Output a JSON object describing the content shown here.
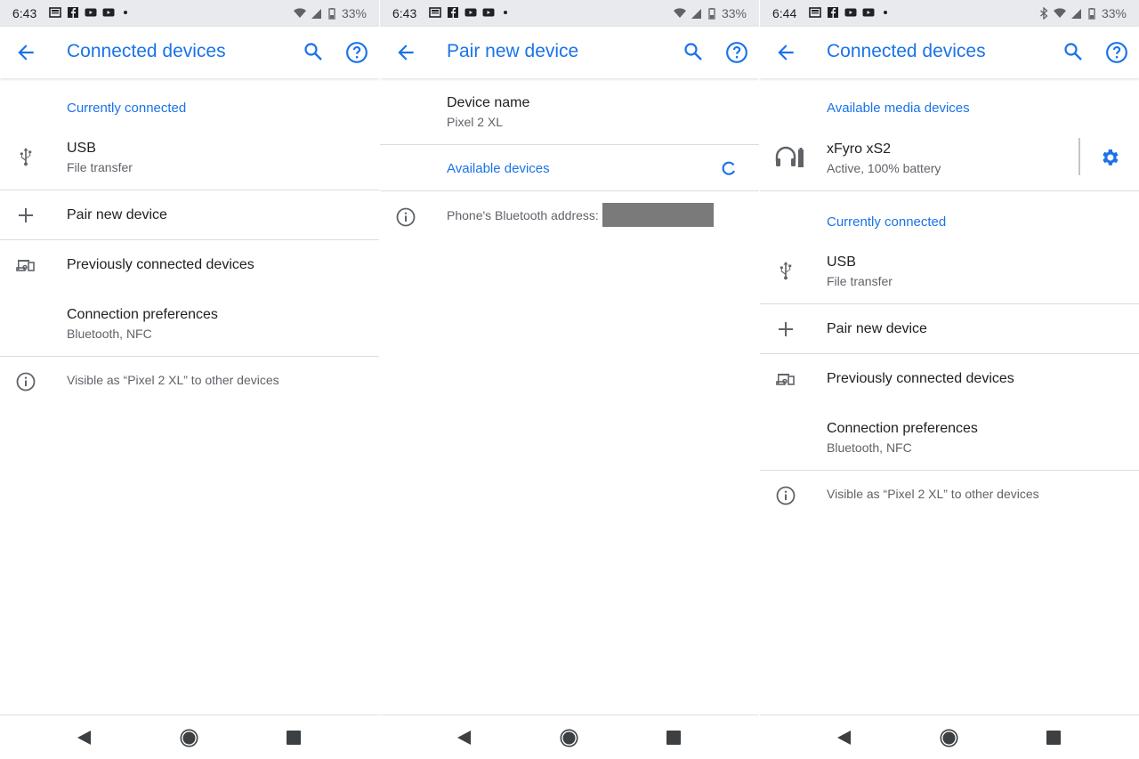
{
  "colors": {
    "accent": "#1a73e8",
    "primary_text": "#202124",
    "secondary_text": "#5f6368"
  },
  "panels": [
    {
      "status": {
        "time": "6:43",
        "battery": "33%"
      },
      "title": "Connected devices",
      "section_current": "Currently connected",
      "usb_title": "USB",
      "usb_sub": "File transfer",
      "pair": "Pair new device",
      "previous": "Previously connected devices",
      "prefs_title": "Connection preferences",
      "prefs_sub": "Bluetooth, NFC",
      "visible": "Visible as “Pixel 2 XL” to other devices"
    },
    {
      "status": {
        "time": "6:43",
        "battery": "33%"
      },
      "title": "Pair new device",
      "device_name_label": "Device name",
      "device_name_value": "Pixel 2 XL",
      "available": "Available devices",
      "bt_address": "Phone's Bluetooth address:"
    },
    {
      "status": {
        "time": "6:44",
        "battery": "33%"
      },
      "title": "Connected devices",
      "section_media": "Available media devices",
      "device_title": "xFyro xS2",
      "device_sub": "Active, 100% battery",
      "section_current": "Currently connected",
      "usb_title": "USB",
      "usb_sub": "File transfer",
      "pair": "Pair new device",
      "previous": "Previously connected devices",
      "prefs_title": "Connection preferences",
      "prefs_sub": "Bluetooth, NFC",
      "visible": "Visible as “Pixel 2 XL” to other devices"
    }
  ]
}
